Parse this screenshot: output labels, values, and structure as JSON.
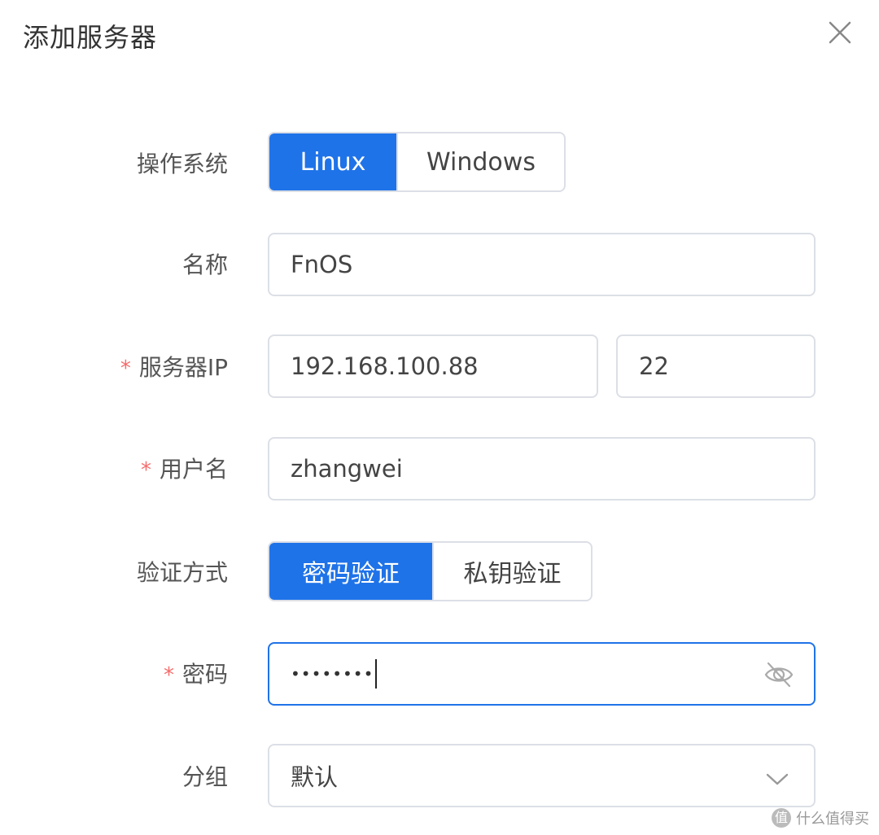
{
  "dialog": {
    "title": "添加服务器"
  },
  "form": {
    "os": {
      "label": "操作系统",
      "options": [
        "Linux",
        "Windows"
      ],
      "selected": "Linux"
    },
    "name": {
      "label": "名称",
      "value": "FnOS"
    },
    "server_ip": {
      "required_mark": "*",
      "label": "服务器IP",
      "ip_value": "192.168.100.88",
      "port_value": "22"
    },
    "username": {
      "required_mark": "*",
      "label": "用户名",
      "value": "zhangwei"
    },
    "auth_method": {
      "label": "验证方式",
      "options": [
        "密码验证",
        "私钥验证"
      ],
      "selected": "密码验证"
    },
    "password": {
      "required_mark": "*",
      "label": "密码",
      "masked_value": "••••••••"
    },
    "group": {
      "label": "分组",
      "value": "默认"
    }
  },
  "icons": {
    "close": "close-icon",
    "password_toggle": "eye-off-icon",
    "dropdown": "chevron-down-icon"
  },
  "colors": {
    "primary": "#1f73e8",
    "required": "#f56c6c",
    "border": "#dcdfe6"
  },
  "watermark": {
    "badge": "值",
    "text": "什么值得买"
  }
}
